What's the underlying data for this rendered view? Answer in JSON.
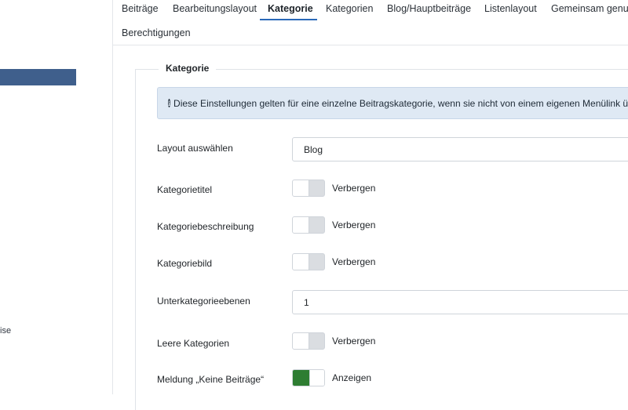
{
  "sidebar": {
    "fragment_text": "ise"
  },
  "tabs": [
    {
      "label": "Beiträge"
    },
    {
      "label": "Bearbeitungslayout"
    },
    {
      "label": "Kategorie",
      "active": true
    },
    {
      "label": "Kategorien"
    },
    {
      "label": "Blog/Hauptbeiträge"
    },
    {
      "label": "Listenlayout"
    },
    {
      "label": "Gemeinsam genutz"
    },
    {
      "label": "Berechtigungen"
    }
  ],
  "fieldset": {
    "legend": "Kategorie",
    "alert_text": "Diese Einstellungen gelten für eine einzelne Beitragskategorie, wenn sie nicht von einem eigenen Menülink übersc"
  },
  "fields": {
    "layout": {
      "label": "Layout auswählen",
      "value": "Blog"
    },
    "kategorietitel": {
      "label": "Kategorietitel",
      "state": "Verbergen"
    },
    "kategoriebeschreibung": {
      "label": "Kategoriebeschreibung",
      "state": "Verbergen"
    },
    "kategoriebild": {
      "label": "Kategoriebild",
      "state": "Verbergen"
    },
    "unterkategorieebenen": {
      "label": "Unterkategorieebenen",
      "value": "1"
    },
    "leere_kategorien": {
      "label": "Leere Kategorien",
      "state": "Verbergen"
    },
    "keine_beitraege": {
      "label": "Meldung „Keine Beiträge“",
      "state": "Anzeigen"
    }
  },
  "colors": {
    "accent": "#2a69b8",
    "sidebar_active": "#3f5f8c",
    "toggle_on": "#2e7d32",
    "alert_bg": "#dfe9f4"
  },
  "icons": {
    "alert": "info-circle-icon"
  }
}
